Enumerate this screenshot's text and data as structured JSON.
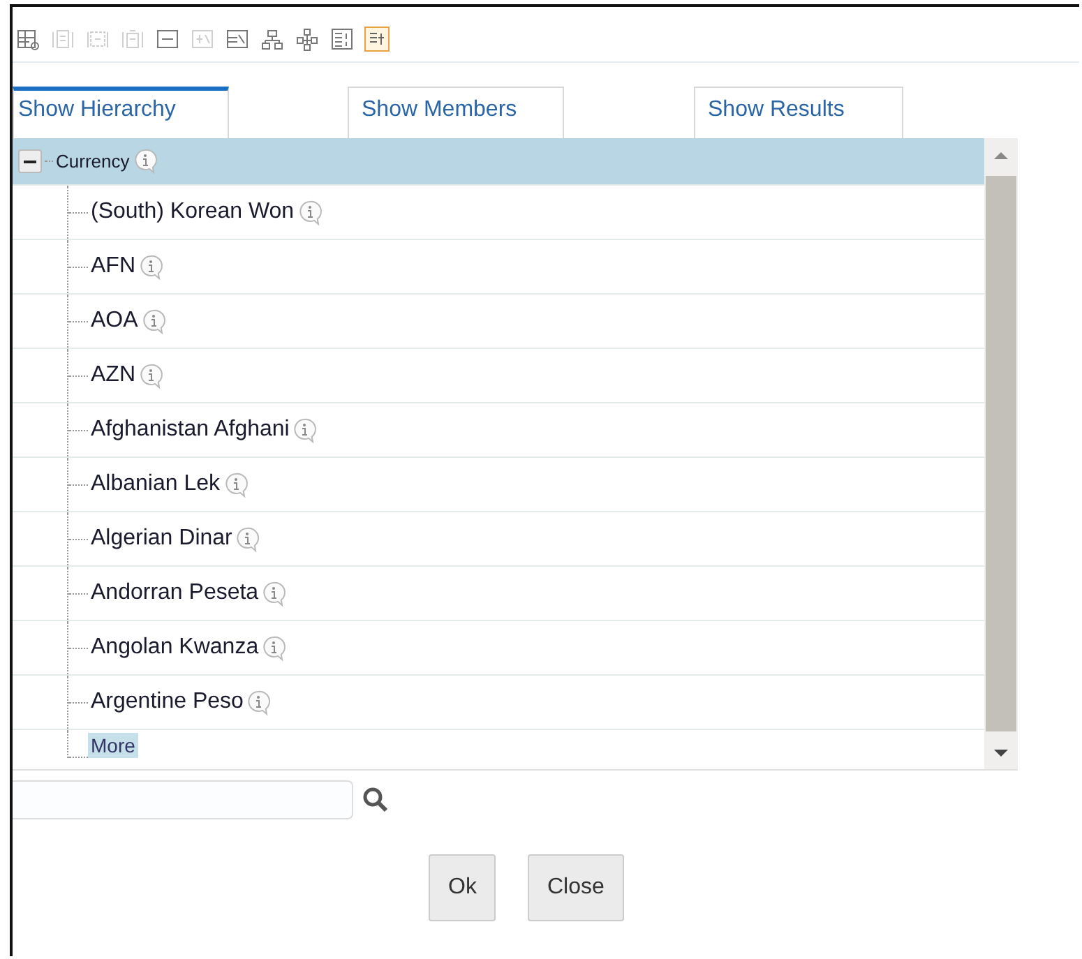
{
  "toolbar": [
    {
      "disabled": false,
      "selected": false
    },
    {
      "disabled": true,
      "selected": false
    },
    {
      "disabled": true,
      "selected": false
    },
    {
      "disabled": true,
      "selected": false
    },
    {
      "disabled": false,
      "selected": false
    },
    {
      "disabled": true,
      "selected": false
    },
    {
      "disabled": false,
      "selected": false
    },
    {
      "disabled": false,
      "selected": false
    },
    {
      "disabled": false,
      "selected": false
    },
    {
      "disabled": false,
      "selected": false
    },
    {
      "disabled": false,
      "selected": true
    }
  ],
  "tabs": [
    {
      "label": "Show Hierarchy",
      "selected": true
    },
    {
      "label": "Show Members",
      "selected": false
    },
    {
      "label": "Show Results",
      "selected": false
    }
  ],
  "tree": [
    {
      "label": "Currency",
      "expanded": true,
      "selected": true,
      "children": [
        {
          "label": "(South) Korean Won",
          "selected": false
        },
        {
          "label": "AFN",
          "selected": false
        },
        {
          "label": "AOA",
          "selected": false
        },
        {
          "label": "AZN",
          "selected": false
        },
        {
          "label": "Afghanistan Afghani",
          "selected": false
        },
        {
          "label": "Albanian Lek",
          "selected": false
        },
        {
          "label": "Algerian Dinar",
          "selected": false
        },
        {
          "label": "Andorran Peseta",
          "selected": false
        },
        {
          "label": "Angolan Kwanza",
          "selected": false
        },
        {
          "label": "Argentine Peso",
          "selected": false
        },
        {
          "label": "More",
          "selected": true,
          "kind": "more"
        }
      ]
    }
  ],
  "buttons": [
    "Ok",
    "Close"
  ]
}
